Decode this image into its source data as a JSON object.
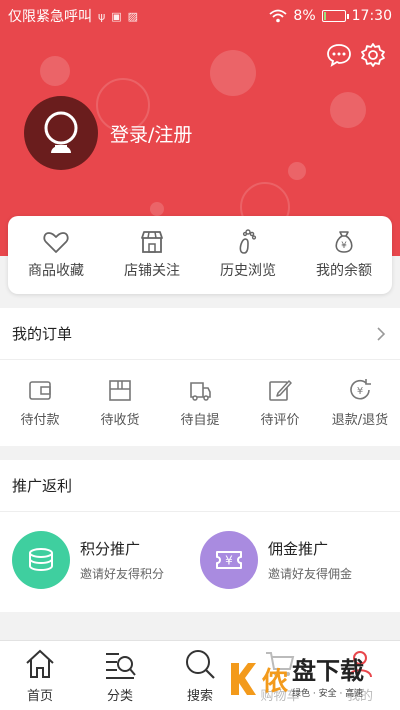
{
  "status_bar": {
    "carrier": "仅限紧急呼叫",
    "battery_percent_text": "8%",
    "battery_level": 0.08,
    "time": "17:30"
  },
  "header": {
    "login_label": "登录/注册",
    "icons": [
      "message-icon",
      "settings-icon"
    ]
  },
  "quick_links": [
    {
      "label": "商品收藏",
      "icon": "heart-icon"
    },
    {
      "label": "店铺关注",
      "icon": "store-icon"
    },
    {
      "label": "历史浏览",
      "icon": "footprint-icon"
    },
    {
      "label": "我的余额",
      "icon": "money-bag-icon"
    }
  ],
  "orders": {
    "title": "我的订单",
    "items": [
      {
        "label": "待付款",
        "icon": "wallet-icon"
      },
      {
        "label": "待收货",
        "icon": "box-icon"
      },
      {
        "label": "待自提",
        "icon": "truck-icon"
      },
      {
        "label": "待评价",
        "icon": "edit-icon"
      },
      {
        "label": "退款/退货",
        "icon": "refund-icon"
      }
    ]
  },
  "promotion": {
    "title": "推广返利",
    "items": [
      {
        "title": "积分推广",
        "subtitle": "邀请好友得积分",
        "color": "#3fcf9f",
        "icon": "coins-icon"
      },
      {
        "title": "佣金推广",
        "subtitle": "邀请好友得佣金",
        "color": "#a98be0",
        "icon": "yen-ticket-icon"
      }
    ]
  },
  "bottom_nav": [
    {
      "label": "首页",
      "icon": "home-icon"
    },
    {
      "label": "分类",
      "icon": "category-icon"
    },
    {
      "label": "搜索",
      "icon": "search-icon"
    },
    {
      "label": "购物车",
      "icon": "cart-icon"
    },
    {
      "label": "我的",
      "icon": "user-icon"
    }
  ],
  "watermark": {
    "char": "侬",
    "brand": "盘下载",
    "tagline": "绿色 · 安全 · 高速"
  },
  "colors": {
    "brand_red": "#e8474c",
    "green": "#3fcf9f",
    "purple": "#a98be0"
  }
}
